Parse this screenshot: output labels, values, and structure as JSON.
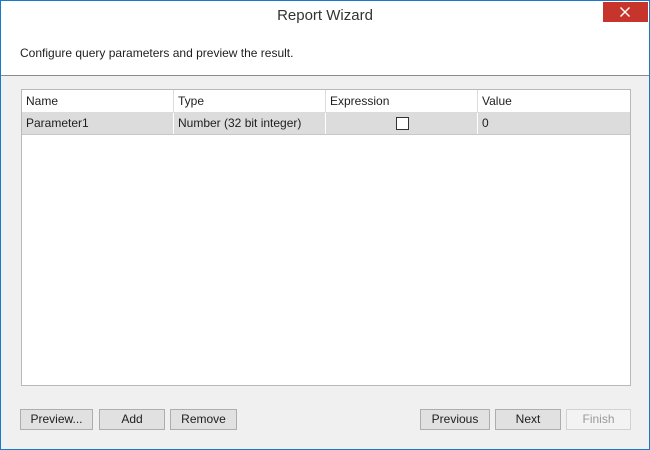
{
  "window": {
    "title": "Report Wizard"
  },
  "header": {
    "text": "Configure query parameters and preview the result."
  },
  "grid": {
    "columns": [
      "Name",
      "Type",
      "Expression",
      "Value"
    ],
    "rows": [
      {
        "name": "Parameter1",
        "type": "Number (32 bit integer)",
        "expression_checked": false,
        "value": "0"
      }
    ]
  },
  "buttons": {
    "preview": "Preview...",
    "add": "Add",
    "remove": "Remove",
    "previous": "Previous",
    "next": "Next",
    "finish": "Finish",
    "finish_enabled": false
  },
  "colors": {
    "window_border": "#1979ca",
    "close_button": "#c7342b",
    "selected_row": "#dcdcdc"
  },
  "icons": {
    "close": "close-icon"
  }
}
